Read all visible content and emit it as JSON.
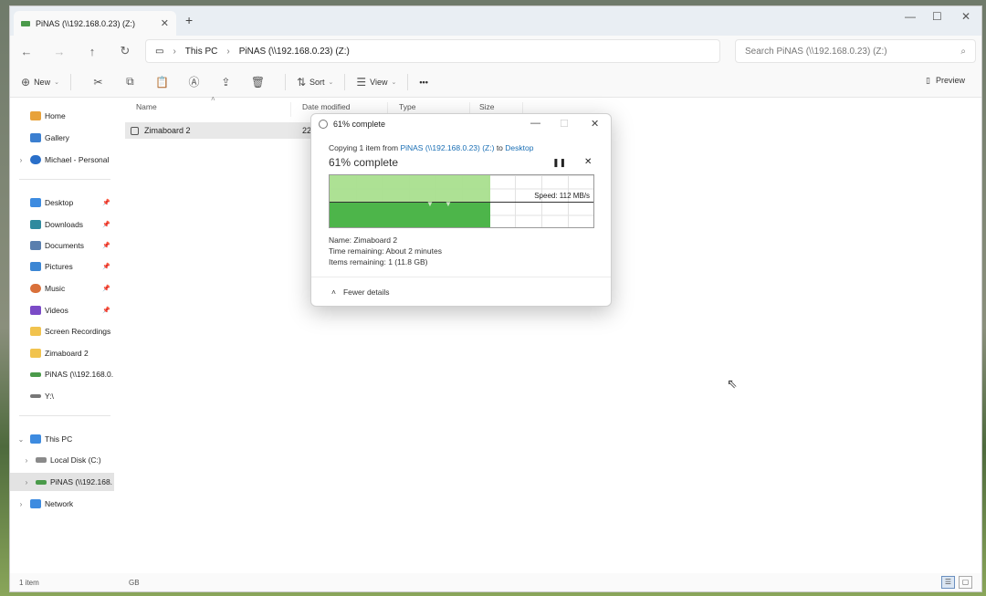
{
  "tab": {
    "title": "PiNAS (\\\\192.168.0.23) (Z:)",
    "close": "✕",
    "new": "+"
  },
  "window_controls": {
    "minimize": "—",
    "maximize": "☐",
    "close": "✕"
  },
  "address": {
    "crumbs": [
      "This PC",
      "PiNAS (\\\\192.168.0.23) (Z:)"
    ],
    "search_placeholder": "Search PiNAS (\\\\192.168.0.23) (Z:)"
  },
  "commands": {
    "new": "New",
    "sort": "Sort",
    "view": "View",
    "more": "•••",
    "preview": "Preview"
  },
  "sidebar": {
    "items": [
      {
        "label": "Home"
      },
      {
        "label": "Gallery"
      },
      {
        "label": "Michael - Personal"
      },
      {
        "label": "Desktop"
      },
      {
        "label": "Downloads"
      },
      {
        "label": "Documents"
      },
      {
        "label": "Pictures"
      },
      {
        "label": "Music"
      },
      {
        "label": "Videos"
      },
      {
        "label": "Screen Recordings"
      },
      {
        "label": "Zimaboard 2"
      },
      {
        "label": "PiNAS (\\\\192.168.0."
      },
      {
        "label": "Y:\\"
      },
      {
        "label": "This PC"
      },
      {
        "label": "Local Disk (C:)"
      },
      {
        "label": "PiNAS (\\\\192.168."
      },
      {
        "label": "Network"
      }
    ]
  },
  "columns": {
    "name": "Name",
    "date": "Date modified",
    "type": "Type",
    "size": "Size"
  },
  "files": [
    {
      "name": "Zimaboard 2",
      "date_partial": "22"
    }
  ],
  "status": {
    "text": "1 item",
    "extra": "GB"
  },
  "dialog": {
    "title": "61% complete",
    "copying_prefix": "Copying 1 item from",
    "source": "PiNAS (\\\\192.168.0.23) (Z:)",
    "to": "to",
    "destination": "Desktop",
    "progress_text": "61% complete",
    "progress": 0.61,
    "pause": "❚❚",
    "cancel": "✕",
    "speed": "Speed: 112 MB/s",
    "name_line": "Name:  Zimaboard 2",
    "time_line": "Time remaining:  About 2 minutes",
    "items_line": "Items remaining:  1 (11.8 GB)",
    "fewer_details": "Fewer details",
    "colors": {
      "fill_light": "#a9df8e",
      "fill_dark": "#4db54a",
      "link": "#1a6fb5"
    }
  }
}
